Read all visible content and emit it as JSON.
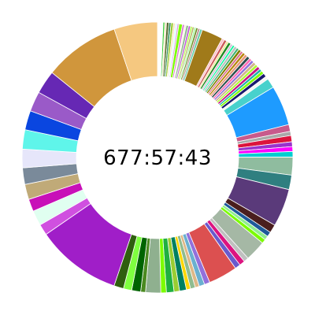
{
  "chart_data": {
    "type": "pie",
    "donut": true,
    "legend": "none",
    "center_text": "677:57:43",
    "slices": [
      {
        "value": 0.8,
        "color": "#ffffff"
      },
      {
        "value": 0.25,
        "color": "#32cd32"
      },
      {
        "value": 0.25,
        "color": "#ffe4b5"
      },
      {
        "value": 0.35,
        "color": "#556b2f"
      },
      {
        "value": 0.3,
        "color": "#2e8b57"
      },
      {
        "value": 0.35,
        "color": "#9acd32"
      },
      {
        "value": 0.25,
        "color": "#ffdead"
      },
      {
        "value": 0.3,
        "color": "#e0ffff"
      },
      {
        "value": 0.25,
        "color": "#dda0dd"
      },
      {
        "value": 0.5,
        "color": "#7cfc00"
      },
      {
        "value": 0.3,
        "color": "#da70d6"
      },
      {
        "value": 0.25,
        "color": "#f5f5dc"
      },
      {
        "value": 0.35,
        "color": "#8fbc8f"
      },
      {
        "value": 0.3,
        "color": "#ba55d3"
      },
      {
        "value": 0.25,
        "color": "#adff2f"
      },
      {
        "value": 0.3,
        "color": "#bdb76b"
      },
      {
        "value": 0.25,
        "color": "#98fb98"
      },
      {
        "value": 0.3,
        "color": "#6b8e23"
      },
      {
        "value": 0.3,
        "color": "#bc8f8f"
      },
      {
        "value": 0.35,
        "color": "#66cdaa"
      },
      {
        "value": 3.1,
        "color": "#a07a1a"
      },
      {
        "value": 0.35,
        "color": "#ffc0cb"
      },
      {
        "value": 0.4,
        "color": "#cd5c5c"
      },
      {
        "value": 0.3,
        "color": "#f0e68c"
      },
      {
        "value": 0.4,
        "color": "#228b22"
      },
      {
        "value": 0.35,
        "color": "#d8bfd8"
      },
      {
        "value": 0.3,
        "color": "#00fa9a"
      },
      {
        "value": 0.4,
        "color": "#c0c0c0"
      },
      {
        "value": 0.35,
        "color": "#3cb371"
      },
      {
        "value": 0.4,
        "color": "#808000"
      },
      {
        "value": 0.35,
        "color": "#db7093"
      },
      {
        "value": 0.4,
        "color": "#b8860b"
      },
      {
        "value": 0.4,
        "color": "#e9967a"
      },
      {
        "value": 0.45,
        "color": "#2f4f4f"
      },
      {
        "value": 0.4,
        "color": "#ff69b4"
      },
      {
        "value": 0.4,
        "color": "#9370db"
      },
      {
        "value": 0.45,
        "color": "#d2b48c"
      },
      {
        "value": 0.4,
        "color": "#adff2f"
      },
      {
        "value": 0.45,
        "color": "#c71585"
      },
      {
        "value": 0.4,
        "color": "#20b2aa"
      },
      {
        "value": 0.45,
        "color": "#7fff00"
      },
      {
        "value": 0.55,
        "color": "#191970"
      },
      {
        "value": 0.45,
        "color": "#f5f5f5"
      },
      {
        "value": 1.4,
        "color": "#48d1cc"
      },
      {
        "value": 5.8,
        "color": "#1e9bff"
      },
      {
        "value": 1.0,
        "color": "#c85a8c"
      },
      {
        "value": 0.6,
        "color": "#a9a9a9"
      },
      {
        "value": 0.9,
        "color": "#dc143c"
      },
      {
        "value": 0.7,
        "color": "#9932cc"
      },
      {
        "value": 0.7,
        "color": "#ff00ff"
      },
      {
        "value": 0.8,
        "color": "#00ced1"
      },
      {
        "value": 2.6,
        "color": "#8fbc9f"
      },
      {
        "value": 2.1,
        "color": "#2f7f80"
      },
      {
        "value": 5.5,
        "color": "#5a3a7a"
      },
      {
        "value": 1.2,
        "color": "#4a1e1e"
      },
      {
        "value": 0.7,
        "color": "#1e5a9a"
      },
      {
        "value": 0.6,
        "color": "#90ee90"
      },
      {
        "value": 0.6,
        "color": "#7cfc00"
      },
      {
        "value": 3.0,
        "color": "#a5b8a5"
      },
      {
        "value": 0.7,
        "color": "#c0c0c0"
      },
      {
        "value": 0.8,
        "color": "#dc1480"
      },
      {
        "value": 0.8,
        "color": "#6a5acd"
      },
      {
        "value": 4.2,
        "color": "#dc5050"
      },
      {
        "value": 0.8,
        "color": "#9370db"
      },
      {
        "value": 0.8,
        "color": "#6ab0d0"
      },
      {
        "value": 0.6,
        "color": "#deb887"
      },
      {
        "value": 0.7,
        "color": "#8fbc8f"
      },
      {
        "value": 0.6,
        "color": "#ffd700"
      },
      {
        "value": 1.0,
        "color": "#008060"
      },
      {
        "value": 0.8,
        "color": "#9acd32"
      },
      {
        "value": 1.1,
        "color": "#20b040"
      },
      {
        "value": 0.8,
        "color": "#7cfc00"
      },
      {
        "value": 2.2,
        "color": "#8fb08f"
      },
      {
        "value": 0.7,
        "color": "#4a8a20"
      },
      {
        "value": 1.3,
        "color": "#006400"
      },
      {
        "value": 1.2,
        "color": "#7fff40"
      },
      {
        "value": 1.4,
        "color": "#2f5f0f"
      },
      {
        "value": 12.4,
        "color": "#a01ec8"
      },
      {
        "value": 1.6,
        "color": "#d050e0"
      },
      {
        "value": 2.2,
        "color": "#e0fff0"
      },
      {
        "value": 1.8,
        "color": "#c810b8"
      },
      {
        "value": 2.2,
        "color": "#c0aa78"
      },
      {
        "value": 2.4,
        "color": "#7a8a9a"
      },
      {
        "value": 2.7,
        "color": "#e6e6fa"
      },
      {
        "value": 2.8,
        "color": "#5ff5ea"
      },
      {
        "value": 2.8,
        "color": "#0a46e0"
      },
      {
        "value": 2.9,
        "color": "#9a5ac8"
      },
      {
        "value": 3.4,
        "color": "#6628b4"
      },
      {
        "value": 11.0,
        "color": "#d0963c"
      },
      {
        "value": 6.3,
        "color": "#f5c880"
      }
    ]
  }
}
